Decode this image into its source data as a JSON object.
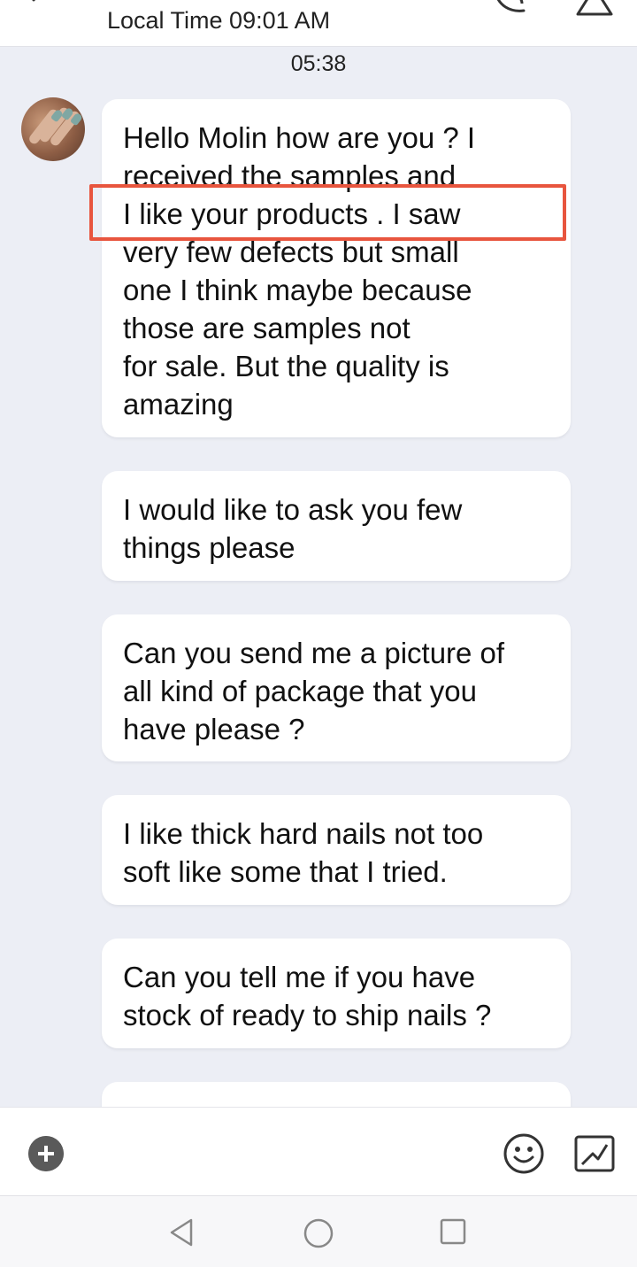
{
  "header": {
    "local_time": "Local Time 09:01 AM"
  },
  "chat": {
    "time_label": "05:38",
    "messages": [
      {
        "lines": [
          "Hello Molin how are you ? I",
          "received the samples and",
          "I like your products . I saw",
          "very few defects but small",
          "one I think maybe because",
          "those are samples not",
          "for sale. But the quality is",
          "amazing"
        ]
      },
      {
        "lines": [
          "I would like to ask you few",
          "things please"
        ]
      },
      {
        "lines": [
          "Can you send me a picture of",
          "all kind of package that you",
          "have please ?"
        ]
      },
      {
        "lines": [
          "I like thick hard nails not too",
          "soft like some that I tried."
        ]
      },
      {
        "lines": [
          "Can you tell me if you have",
          "stock of ready to ship nails ?"
        ]
      }
    ]
  },
  "colors": {
    "highlight": "#e8553e",
    "chat_background": "#eceef5",
    "bubble": "#ffffff"
  },
  "icons": {
    "back": "back-icon",
    "call": "phone-icon",
    "warning": "warning-icon",
    "add": "plus-icon",
    "emoji": "smiley-icon",
    "image": "image-icon",
    "nav_back": "triangle-back-icon",
    "nav_home": "circle-home-icon",
    "nav_recent": "square-recent-icon"
  }
}
